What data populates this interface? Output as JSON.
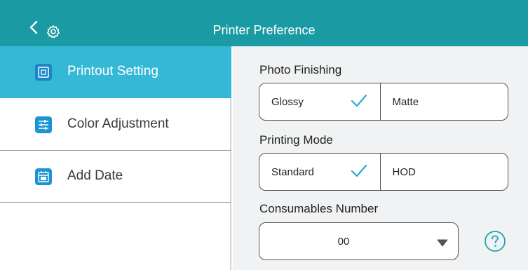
{
  "header": {
    "title": "Printer Preference",
    "back_icon": "chevron-left-icon",
    "settings_icon": "gear-icon",
    "background_color": "#1a9aa3"
  },
  "sidebar": {
    "items": [
      {
        "label": "Printout Setting",
        "icon": "printout-icon",
        "active": true
      },
      {
        "label": "Color Adjustment",
        "icon": "sliders-icon",
        "active": false
      },
      {
        "label": "Add Date",
        "icon": "calendar-icon",
        "active": false
      }
    ],
    "active_color": "#35b8d6"
  },
  "main": {
    "photo_finishing": {
      "label": "Photo Finishing",
      "options": [
        "Glossy",
        "Matte"
      ],
      "selected": "Glossy"
    },
    "printing_mode": {
      "label": "Printing Mode",
      "options": [
        "Standard",
        "HOD"
      ],
      "selected": "Standard"
    },
    "consumables": {
      "label": "Consumables Number",
      "value": "00",
      "help_icon": "question-circle-icon"
    }
  },
  "colors": {
    "accent": "#1aa4b4",
    "check": "#29a9d8"
  }
}
